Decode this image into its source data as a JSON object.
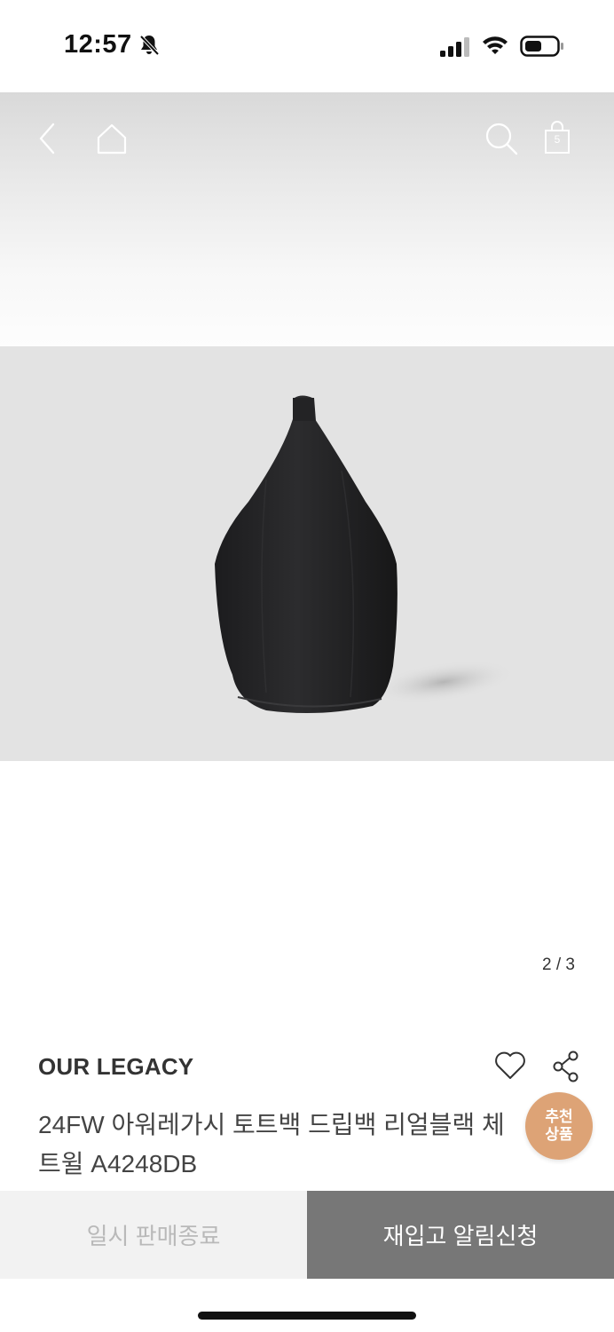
{
  "status_bar": {
    "time": "12:57",
    "icons": [
      "bell-slash-icon",
      "signal-icon",
      "wifi-icon",
      "battery-icon"
    ]
  },
  "header": {
    "icons": [
      "back-icon",
      "home-icon",
      "search-icon",
      "cart-icon"
    ],
    "cart_count": "5"
  },
  "gallery": {
    "page_indicator": "2 / 3",
    "current_page": 2,
    "total_pages": 3
  },
  "product": {
    "brand": "OUR LEGACY",
    "name": "24FW 아워레가시 토트백 드립백 리얼블랙 체\n트윌 A4248DB",
    "actions": [
      "heart-icon",
      "share-icon"
    ]
  },
  "floating": {
    "recommend_line1": "추천",
    "recommend_line2": "상품"
  },
  "bottom_bar": {
    "soldout_label": "일시 판매종료",
    "restock_label": "재입고 알림신청"
  },
  "colors": {
    "accent_badge": "#dc9f6f",
    "restock_button": "#777777",
    "soldout_button": "#f2f2f2"
  }
}
